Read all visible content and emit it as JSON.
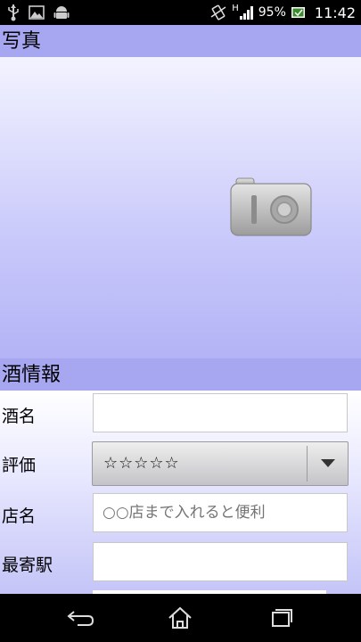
{
  "status_bar": {
    "battery_percent": "95%",
    "time": "11:42",
    "network_label": "H"
  },
  "photo_section": {
    "title": "写真",
    "camera_icon": "camera-icon"
  },
  "info_section": {
    "title": "酒情報",
    "fields": {
      "sake_name": {
        "label": "酒名",
        "value": "",
        "placeholder": ""
      },
      "rating": {
        "label": "評価",
        "value": "☆☆☆☆☆"
      },
      "shop_name": {
        "label": "店名",
        "value": "",
        "placeholder": "○○店まで入れると便利"
      },
      "station": {
        "label": "最寄駅",
        "value": "",
        "placeholder": ""
      }
    }
  },
  "nav_bar": {
    "back_icon": "back-icon",
    "home_icon": "home-icon",
    "recents_icon": "recents-icon"
  }
}
